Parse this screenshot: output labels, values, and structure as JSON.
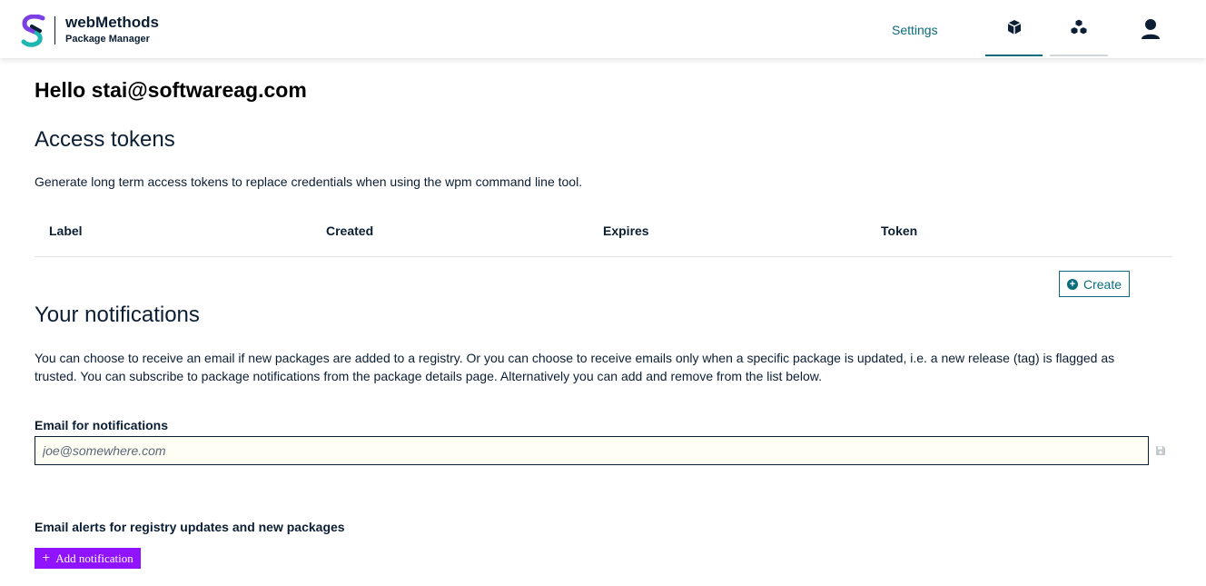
{
  "header": {
    "brand_title": "webMethods",
    "brand_subtitle": "Package Manager",
    "nav_settings": "Settings",
    "colors": {
      "accent": "#0b6c7c",
      "logo_purple": "#7b3fe4",
      "logo_teal": "#1fb5b0",
      "logo_navy": "#0b1e33"
    },
    "icons": [
      "package-icon",
      "packages-icon",
      "user-icon"
    ]
  },
  "greeting": "Hello stai@softwareag.com",
  "access_tokens": {
    "title": "Access tokens",
    "description": "Generate long term access tokens to replace credentials when using the wpm command line tool.",
    "columns": [
      "Label",
      "Created",
      "Expires",
      "Token"
    ],
    "rows": [],
    "create_label": "Create"
  },
  "notifications": {
    "title": "Your notifications",
    "description": "You can choose to receive an email if new packages are added to a registry. Or you can choose to receive emails only when a specific package is updated, i.e. a new release (tag) is flagged as trusted. You can subscribe to package notifications from the package details page. Alternatively you can add and remove from the list below.",
    "email_label": "Email for notifications",
    "email_placeholder": "joe@somewhere.com",
    "email_value": "",
    "alerts_label": "Email alerts for registry updates and new packages",
    "add_label": "Add  notification",
    "add_color": "#9013fe"
  }
}
